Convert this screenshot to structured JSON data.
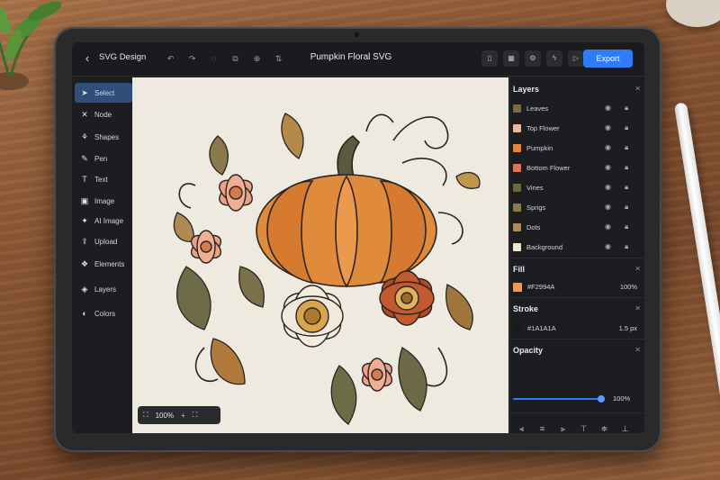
{
  "app": {
    "title": "SVG Design",
    "document_title": "Pumpkin Floral SVG",
    "export_label": "Export"
  },
  "toolbar_icons": [
    "undo-icon",
    "redo-icon",
    "group-icon",
    "ungroup-icon",
    "duplicate-icon",
    "arrange-icon"
  ],
  "sidebar": {
    "items": [
      {
        "label": "Select",
        "icon": "pointer-icon",
        "active": true
      },
      {
        "label": "Node",
        "icon": "node-icon"
      },
      {
        "label": "Shapes",
        "icon": "shapes-icon"
      },
      {
        "label": "Pen",
        "icon": "pen-icon"
      },
      {
        "label": "Text",
        "icon": "text-icon"
      },
      {
        "label": "Image",
        "icon": "image-icon"
      },
      {
        "label": "AI Image",
        "icon": "ai-image-icon"
      },
      {
        "label": "Upload",
        "icon": "upload-icon"
      },
      {
        "label": "Elements",
        "icon": "elements-icon"
      },
      {
        "label": "Layers",
        "icon": "layers-icon"
      },
      {
        "label": "Colors",
        "icon": "colors-icon"
      }
    ]
  },
  "canvas": {
    "zoom": "100%"
  },
  "panel": {
    "layers_title": "Layers",
    "layers": [
      {
        "name": "Leaves",
        "color": "#7a6a4a"
      },
      {
        "name": "Top Flower",
        "color": "#e8b89a"
      },
      {
        "name": "Pumpkin",
        "color": "#e0883a"
      },
      {
        "name": "Bottom Flower",
        "color": "#d9775a"
      },
      {
        "name": "Vines",
        "color": "#6e6840"
      },
      {
        "name": "Sprigs",
        "color": "#8a7a52"
      },
      {
        "name": "Dots",
        "color": "#b08a5a"
      },
      {
        "name": "Background",
        "color": "#efe6d6"
      }
    ],
    "fill_title": "Fill",
    "fill": {
      "hex": "#F2994A",
      "opacity": "100%",
      "color": "#F2994A"
    },
    "stroke_title": "Stroke",
    "stroke": {
      "hex": "#1A1A1A",
      "width": "1.5 px",
      "color": "#1A1A1A"
    },
    "opacity_title": "Opacity",
    "opacity": {
      "value": "100%",
      "level": 1.0
    }
  }
}
